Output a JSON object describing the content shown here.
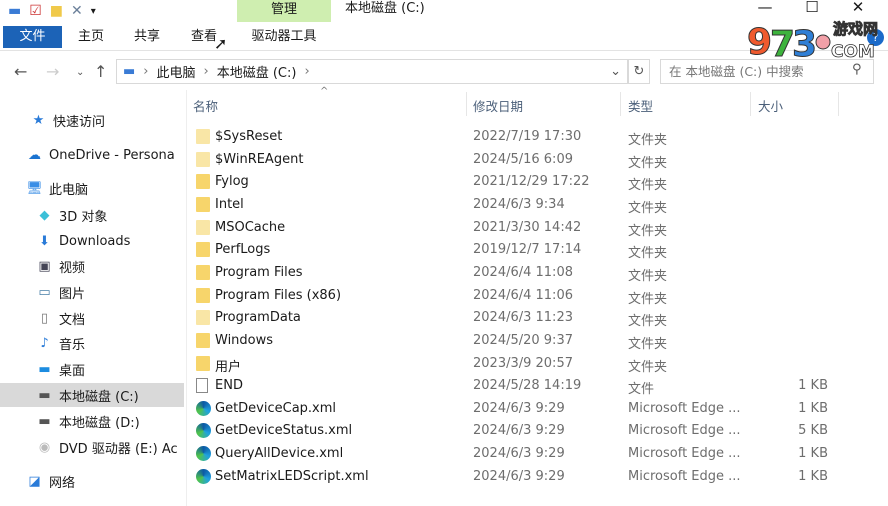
{
  "window": {
    "title": "本地磁盘 (C:)",
    "minimize": "—",
    "maximize": "☐",
    "close": "✕"
  },
  "quick_access_toolbar": {
    "icons": [
      "drive-icon",
      "properties-icon",
      "new-folder-icon",
      "delete-icon",
      "customize-dropdown-icon"
    ]
  },
  "ribbon": {
    "file_tab": "文件",
    "tabs": [
      "主页",
      "共享",
      "查看",
      "驱动器工具"
    ],
    "contextual_group": "管理",
    "colors": {
      "file_tab": "#1c63b7",
      "contextual": "#cfeeb0"
    }
  },
  "address": {
    "breadcrumb": [
      "此电脑",
      "本地磁盘 (C:)"
    ],
    "search_placeholder": "在 本地磁盘 (C:) 中搜索"
  },
  "sidebar": {
    "items": [
      {
        "label": "快速访问",
        "icon": "star-icon"
      },
      {
        "label": "OneDrive - Persona",
        "icon": "cloud-icon"
      },
      {
        "label": "此电脑",
        "icon": "computer-icon"
      },
      {
        "label": "3D 对象",
        "icon": "cube-icon"
      },
      {
        "label": "Downloads",
        "icon": "download-icon"
      },
      {
        "label": "视频",
        "icon": "video-icon"
      },
      {
        "label": "图片",
        "icon": "picture-icon"
      },
      {
        "label": "文档",
        "icon": "document-icon"
      },
      {
        "label": "音乐",
        "icon": "music-icon"
      },
      {
        "label": "桌面",
        "icon": "desktop-icon"
      },
      {
        "label": "本地磁盘 (C:)",
        "icon": "drive-icon",
        "selected": true
      },
      {
        "label": "本地磁盘 (D:)",
        "icon": "drive-icon"
      },
      {
        "label": "DVD 驱动器 (E:) Ac",
        "icon": "dvd-icon"
      },
      {
        "label": "网络",
        "icon": "network-icon"
      }
    ]
  },
  "columns": {
    "name": "名称",
    "date": "修改日期",
    "type": "类型",
    "size": "大小"
  },
  "files": [
    {
      "name": "$SysReset",
      "date": "2022/7/19 17:30",
      "type": "文件夹",
      "size": "",
      "icon": "folder-light"
    },
    {
      "name": "$WinREAgent",
      "date": "2024/5/16 6:09",
      "type": "文件夹",
      "size": "",
      "icon": "folder-light"
    },
    {
      "name": "Fylog",
      "date": "2021/12/29 17:22",
      "type": "文件夹",
      "size": "",
      "icon": "folder"
    },
    {
      "name": "Intel",
      "date": "2024/6/3 9:34",
      "type": "文件夹",
      "size": "",
      "icon": "folder"
    },
    {
      "name": "MSOCache",
      "date": "2021/3/30 14:42",
      "type": "文件夹",
      "size": "",
      "icon": "folder-light"
    },
    {
      "name": "PerfLogs",
      "date": "2019/12/7 17:14",
      "type": "文件夹",
      "size": "",
      "icon": "folder"
    },
    {
      "name": "Program Files",
      "date": "2024/6/4 11:08",
      "type": "文件夹",
      "size": "",
      "icon": "folder"
    },
    {
      "name": "Program Files (x86)",
      "date": "2024/6/4 11:06",
      "type": "文件夹",
      "size": "",
      "icon": "folder"
    },
    {
      "name": "ProgramData",
      "date": "2024/6/3 11:23",
      "type": "文件夹",
      "size": "",
      "icon": "folder-light"
    },
    {
      "name": "Windows",
      "date": "2024/5/20 9:37",
      "type": "文件夹",
      "size": "",
      "icon": "folder"
    },
    {
      "name": "用户",
      "date": "2023/3/9 20:57",
      "type": "文件夹",
      "size": "",
      "icon": "folder"
    },
    {
      "name": "END",
      "date": "2024/5/28 14:19",
      "type": "文件",
      "size": "1 KB",
      "icon": "file"
    },
    {
      "name": "GetDeviceCap.xml",
      "date": "2024/6/3 9:29",
      "type": "Microsoft Edge ...",
      "size": "1 KB",
      "icon": "edge"
    },
    {
      "name": "GetDeviceStatus.xml",
      "date": "2024/6/3 9:29",
      "type": "Microsoft Edge ...",
      "size": "5 KB",
      "icon": "edge"
    },
    {
      "name": "QueryAllDevice.xml",
      "date": "2024/6/3 9:29",
      "type": "Microsoft Edge ...",
      "size": "1 KB",
      "icon": "edge"
    },
    {
      "name": "SetMatrixLEDScript.xml",
      "date": "2024/6/3 9:29",
      "type": "Microsoft Edge ...",
      "size": "1 KB",
      "icon": "edge"
    }
  ],
  "watermark": {
    "text": "9773游戏网.COM"
  }
}
